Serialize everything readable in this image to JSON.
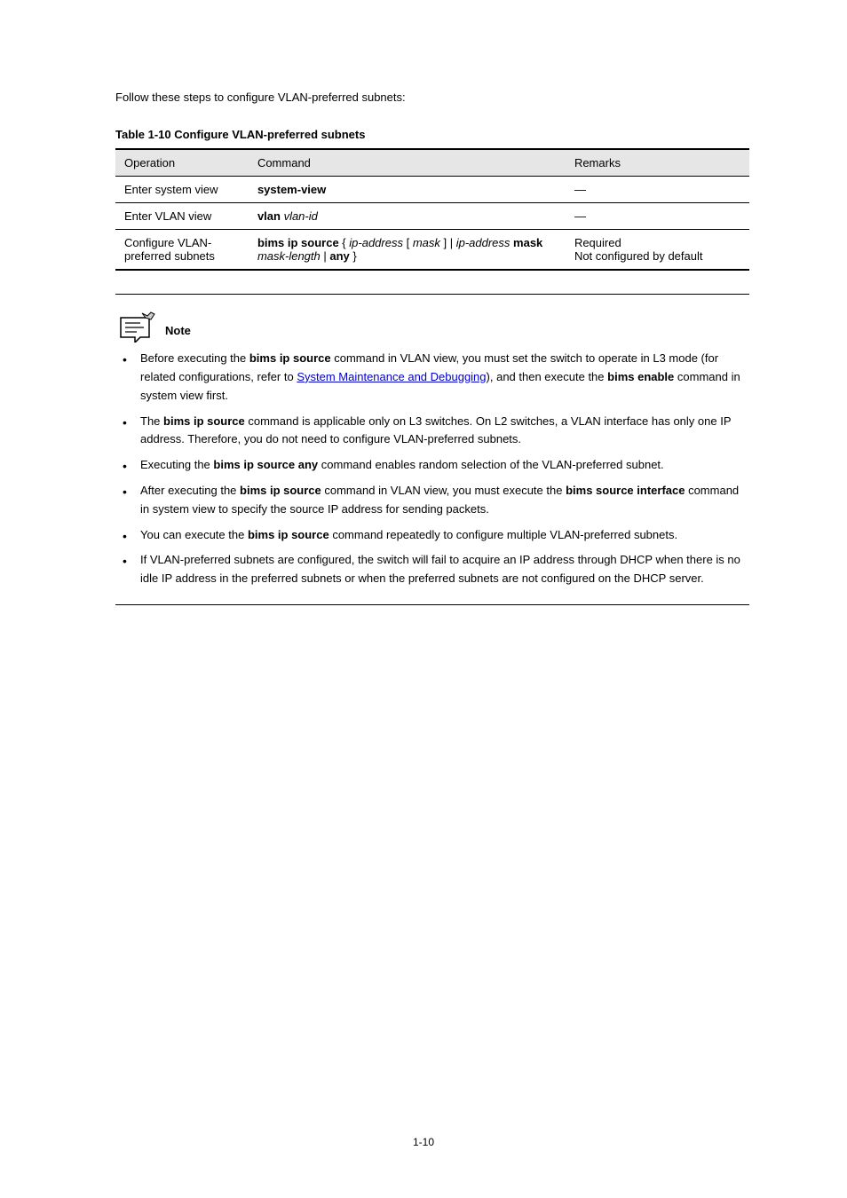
{
  "intro": "Follow these steps to configure VLAN-preferred subnets:",
  "table": {
    "caption": "Table 1-10 Configure VLAN-preferred subnets",
    "headers": [
      "Operation",
      "Command",
      "Remarks"
    ],
    "rows": [
      {
        "op": "Enter system view",
        "cmd": [
          {
            "t": "system-view",
            "b": true
          }
        ],
        "rem": "—"
      },
      {
        "op": "Enter VLAN view",
        "cmd": [
          {
            "t": "vlan ",
            "b": true
          },
          {
            "t": "vlan-id",
            "i": true
          }
        ],
        "rem": "—"
      },
      {
        "op": "Configure VLAN-preferred subnets",
        "cmd": [
          {
            "t": "bims ip source",
            "b": true
          },
          {
            "t": " { "
          },
          {
            "t": "ip-address",
            "i": true
          },
          {
            "t": " [ "
          },
          {
            "t": "mask",
            "i": true
          },
          {
            "t": " ] | "
          },
          {
            "t": "ip-address",
            "i": true
          },
          {
            "t": " "
          },
          {
            "t": "mask",
            "b": true
          },
          {
            "t": " "
          },
          {
            "t": "mask-length",
            "i": true
          },
          {
            "t": " | "
          },
          {
            "t": "any",
            "b": true
          },
          {
            "t": " }"
          }
        ],
        "rem_lines": [
          "Required",
          "Not configured by default"
        ]
      }
    ]
  },
  "note_label": "Note",
  "notes": [
    {
      "parts": [
        {
          "t": "Before executing the "
        },
        {
          "t": "bims ip source",
          "b": true
        },
        {
          "t": " command in VLAN view, you must set the switch to operate in L3 mode (for related configurations, refer to "
        },
        {
          "t": "System Maintenance and Debugging",
          "link": true
        },
        {
          "t": "), and then execute the "
        },
        {
          "t": "bims enable",
          "b": true
        },
        {
          "t": " command in system view first."
        }
      ]
    },
    {
      "parts": [
        {
          "t": "The "
        },
        {
          "t": "bims ip source",
          "b": true
        },
        {
          "t": " command is applicable only on L3 switches. On L2 switches, a VLAN interface has only one IP address. Therefore, you do not need to configure VLAN-preferred subnets."
        }
      ]
    },
    {
      "parts": [
        {
          "t": "Executing the "
        },
        {
          "t": "bims ip source any",
          "b": true
        },
        {
          "t": " command enables random selection of the VLAN-preferred subnet."
        }
      ]
    },
    {
      "parts": [
        {
          "t": "After executing the "
        },
        {
          "t": "bims ip source",
          "b": true
        },
        {
          "t": " command in VLAN view, you must execute the "
        },
        {
          "t": "bims source interface",
          "b": true
        },
        {
          "t": " command in system view to specify the source IP address for sending packets."
        }
      ]
    },
    {
      "parts": [
        {
          "t": "You can execute the "
        },
        {
          "t": "bims ip source ",
          "b": true
        },
        {
          "t": "command repeatedly to configure multiple VLAN-preferred subnets."
        }
      ]
    },
    {
      "parts": [
        {
          "t": "If VLAN-preferred subnets are configured, the switch will fail to acquire an IP address through DHCP when there is no idle IP address in the preferred subnets or when the preferred subnets are not configured on the DHCP server."
        }
      ]
    }
  ],
  "pagenum": "1-10"
}
